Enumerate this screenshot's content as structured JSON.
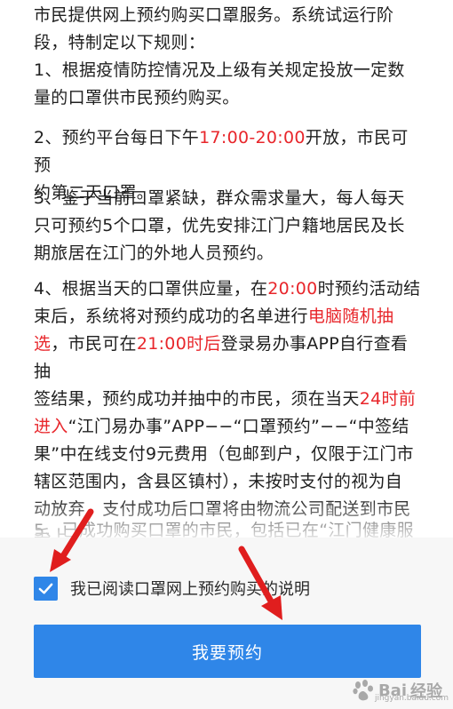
{
  "rules": {
    "intro_line1": "市民提供网上预约购买口罩服务。系统试运行阶",
    "intro_line2": "段，特制定以下规则：",
    "r1_line1": "1、根据疫情防控情况及上级有关规定投放一定数",
    "r1_line2": "量的口罩供市民预约购买。",
    "r2_a": "2、预约平台每日下午",
    "r2_time": "17:00-20:00",
    "r2_b": "开放，市民可预",
    "r2_line2": "约第二天口罩。",
    "r3_line1": "3、鉴于当前口罩紧缺，群众需求量大，每人每天",
    "r3_line2": "只可预约5个口罩，优先安排江门户籍地居民及长",
    "r3_line3": "期旅居在江门的外地人员预约。",
    "r4_a": "4、根据当天的口罩供应量，在",
    "r4_time": "20:00",
    "r4_b": "时预约活动结",
    "r4_c": "束后，系统将对预约成功的名单进行",
    "r4_lottery1": "电脑随机抽",
    "r4_lottery2": "选",
    "r4_d": "，市民可在",
    "r4_after": "21:00时后",
    "r4_e": "登录易办事APP自行查看抽",
    "r4_f": "签结果，预约成功并抽中的市民，须在当天",
    "r4_deadline1": "24时前",
    "r4_deadline2": "进入",
    "r4_g": "“江门易办事”APP−−“口罩预约”−−“中签结",
    "r4_h": "果”中在线支付9元费用（包邮到户，仅限于江门市",
    "r4_i": "辖区范围内，含县区镇村），未按时支付的视为自",
    "r4_j": "动放弃，支付成功后口罩将由物流公司配送到市民",
    "r4_k": "手上。",
    "r5_partial": "5、已成功购买口罩的市民，包括已在“江门健康服"
  },
  "agree": {
    "label": "我已阅读口罩网上预约购买的说明",
    "checked": true
  },
  "button": {
    "label": "我要预约"
  },
  "colors": {
    "accent": "#2f86e8",
    "highlight": "#e8262b",
    "annotation_arrow": "#e01e1e"
  },
  "watermark": {
    "brand": "Bai",
    "brand2": "经验",
    "sub": "jingyan.baidu.com"
  }
}
